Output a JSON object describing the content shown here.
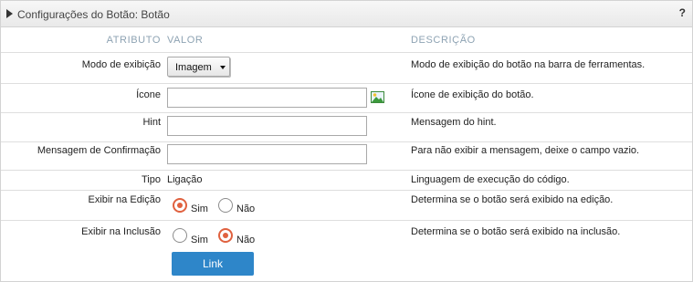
{
  "header": {
    "title": "Configurações do Botão: Botão",
    "help": "?"
  },
  "columns": {
    "attribute": "ATRIBUTO",
    "value": "VALOR",
    "description": "DESCRIÇÃO"
  },
  "rows": {
    "mode": {
      "label": "Modo de exibição",
      "value": "Imagem",
      "description": "Modo de exibição do botão na barra de ferramentas."
    },
    "icon": {
      "label": "Ícone",
      "value": "",
      "description": "Ícone de exibição do botão."
    },
    "hint": {
      "label": "Hint",
      "value": "",
      "description": "Mensagem do hint."
    },
    "confirm": {
      "label": "Mensagem de Confirmação",
      "value": "",
      "description": "Para não exibir a mensagem, deixe o campo vazio."
    },
    "type": {
      "label": "Tipo",
      "value": "Ligação",
      "description": "Linguagem de execução do código."
    },
    "edit": {
      "label": "Exibir na Edição",
      "yes": "Sim",
      "no": "Não",
      "selected": "Sim",
      "description": "Determina se o botão será exibido na edição."
    },
    "insert": {
      "label": "Exibir na Inclusão",
      "yes": "Sim",
      "no": "Não",
      "selected": "Não",
      "description": "Determina se o botão será exibido na inclusão."
    }
  },
  "link_button": "Link",
  "colors": {
    "accent_radio": "#e0613f",
    "button": "#2e86c9",
    "column_header": "#8ea3b3"
  },
  "icons": {
    "header_toggle": "triangle-right-icon",
    "image_picker": "image-icon"
  }
}
